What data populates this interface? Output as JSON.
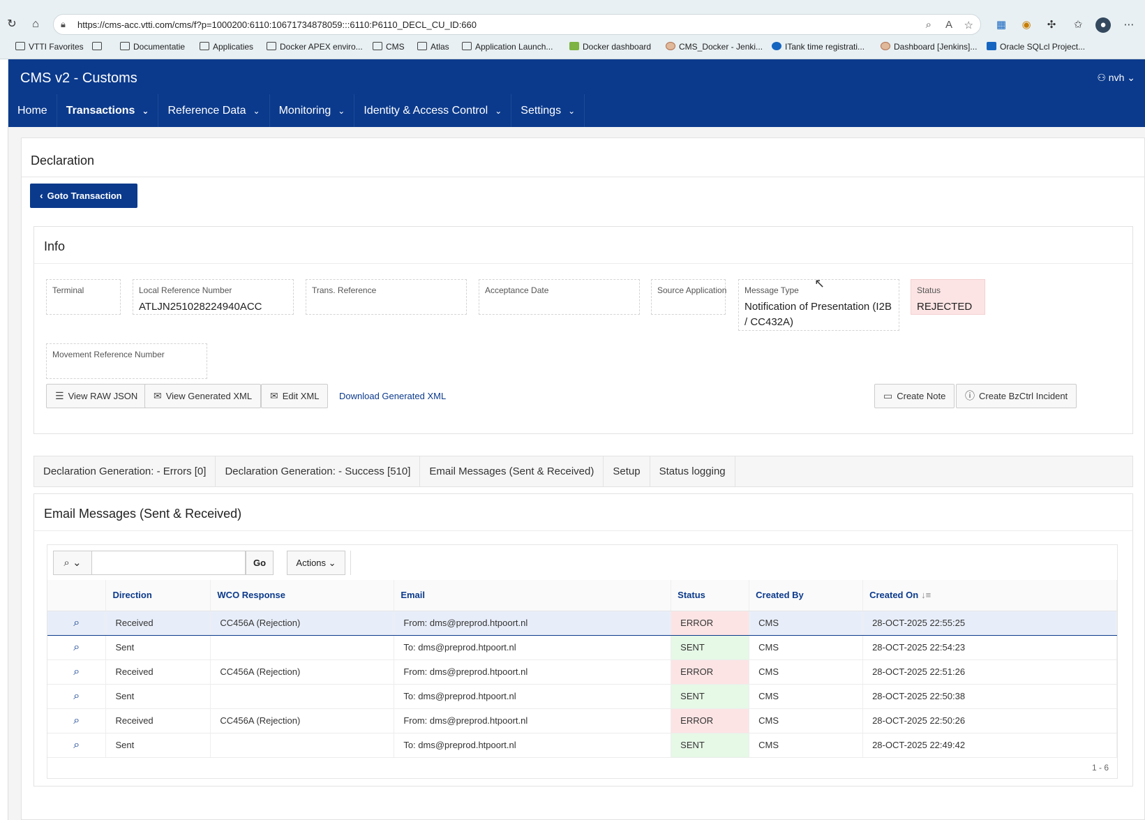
{
  "browser": {
    "url": "https://cms-acc.vtti.com/cms/f?p=1000200:6110:10671734878059:::6110:P6110_DECL_CU_ID:660",
    "bookmarks": [
      {
        "label": "VTTI Favorites",
        "icon": "folder-icon"
      },
      {
        "label": "",
        "icon": "card-icon"
      },
      {
        "label": "Documentatie",
        "icon": "folder-icon"
      },
      {
        "label": "Applicaties",
        "icon": "folder-icon"
      },
      {
        "label": "Docker APEX enviro...",
        "icon": "folder-icon"
      },
      {
        "label": "CMS",
        "icon": "folder-icon"
      },
      {
        "label": "Atlas",
        "icon": "folder-icon"
      },
      {
        "label": "Application Launch...",
        "icon": "app-icon"
      },
      {
        "label": "Docker dashboard",
        "icon": "docker-icon"
      },
      {
        "label": "CMS_Docker - Jenki...",
        "icon": "jenkins-icon"
      },
      {
        "label": "ITank time registrati...",
        "icon": "itank-icon"
      },
      {
        "label": "Dashboard [Jenkins]...",
        "icon": "jenkins-icon"
      },
      {
        "label": "Oracle SQLcl Project...",
        "icon": "p-icon"
      }
    ]
  },
  "app": {
    "title": "CMS v2 - Customs",
    "user": "nvh",
    "menu": [
      {
        "label": "Home",
        "has_menu": false,
        "bold": false
      },
      {
        "label": "Transactions",
        "has_menu": true,
        "bold": true
      },
      {
        "label": "Reference Data",
        "has_menu": true,
        "bold": false
      },
      {
        "label": "Monitoring",
        "has_menu": true,
        "bold": false
      },
      {
        "label": "Identity & Access Control",
        "has_menu": true,
        "bold": false
      },
      {
        "label": "Settings",
        "has_menu": true,
        "bold": false
      }
    ]
  },
  "page": {
    "title": "Declaration",
    "goto_label": "Goto Transaction"
  },
  "info": {
    "title": "Info",
    "fields": {
      "terminal": {
        "label": "Terminal",
        "value": ""
      },
      "lrn": {
        "label": "Local Reference Number",
        "value": "ATLJN251028224940ACC"
      },
      "trans_ref": {
        "label": "Trans. Reference",
        "value": ""
      },
      "acceptance": {
        "label": "Acceptance Date",
        "value": ""
      },
      "source_app": {
        "label": "Source Application",
        "value": ""
      },
      "message_type": {
        "label": "Message Type",
        "value": "Notification of Presentation (I2B / CC432A)"
      },
      "status": {
        "label": "Status",
        "value": "REJECTED"
      },
      "mrn": {
        "label": "Movement Reference Number",
        "value": ""
      }
    },
    "buttons": {
      "view_raw_json": "View RAW JSON",
      "view_generated_xml": "View Generated XML",
      "edit_xml": "Edit XML",
      "download_xml": "Download Generated XML",
      "create_note": "Create Note",
      "create_incident": "Create BzCtrl Incident"
    }
  },
  "tabs": [
    "Declaration Generation: - Errors [0]",
    "Declaration Generation: - Success [510]",
    "Email Messages (Sent & Received)",
    "Setup",
    "Status logging"
  ],
  "email": {
    "title": "Email Messages (Sent & Received)",
    "search_placeholder": "",
    "go_label": "Go",
    "actions_label": "Actions",
    "columns": [
      "",
      "Direction",
      "WCO Response",
      "Email",
      "Status",
      "Created By",
      "Created On"
    ],
    "rows": [
      {
        "direction": "Received",
        "wco": "CC456A (Rejection)",
        "email": "From: dms@preprod.htpoort.nl",
        "status": "ERROR",
        "created_by": "CMS",
        "created_on": "28-OCT-2025 22:55:25"
      },
      {
        "direction": "Sent",
        "wco": "",
        "email": "To: dms@preprod.htpoort.nl",
        "status": "SENT",
        "created_by": "CMS",
        "created_on": "28-OCT-2025 22:54:23"
      },
      {
        "direction": "Received",
        "wco": "CC456A (Rejection)",
        "email": "From: dms@preprod.htpoort.nl",
        "status": "ERROR",
        "created_by": "CMS",
        "created_on": "28-OCT-2025 22:51:26"
      },
      {
        "direction": "Sent",
        "wco": "",
        "email": "To: dms@preprod.htpoort.nl",
        "status": "SENT",
        "created_by": "CMS",
        "created_on": "28-OCT-2025 22:50:38"
      },
      {
        "direction": "Received",
        "wco": "CC456A (Rejection)",
        "email": "From: dms@preprod.htpoort.nl",
        "status": "ERROR",
        "created_by": "CMS",
        "created_on": "28-OCT-2025 22:50:26"
      },
      {
        "direction": "Sent",
        "wco": "",
        "email": "To: dms@preprod.htpoort.nl",
        "status": "SENT",
        "created_by": "CMS",
        "created_on": "28-OCT-2025 22:49:42"
      }
    ],
    "pagination": "1 - 6"
  },
  "colors": {
    "brand": "#0b3a8c",
    "error_bg": "#fde4e4",
    "sent_bg": "#e6f8e6"
  }
}
